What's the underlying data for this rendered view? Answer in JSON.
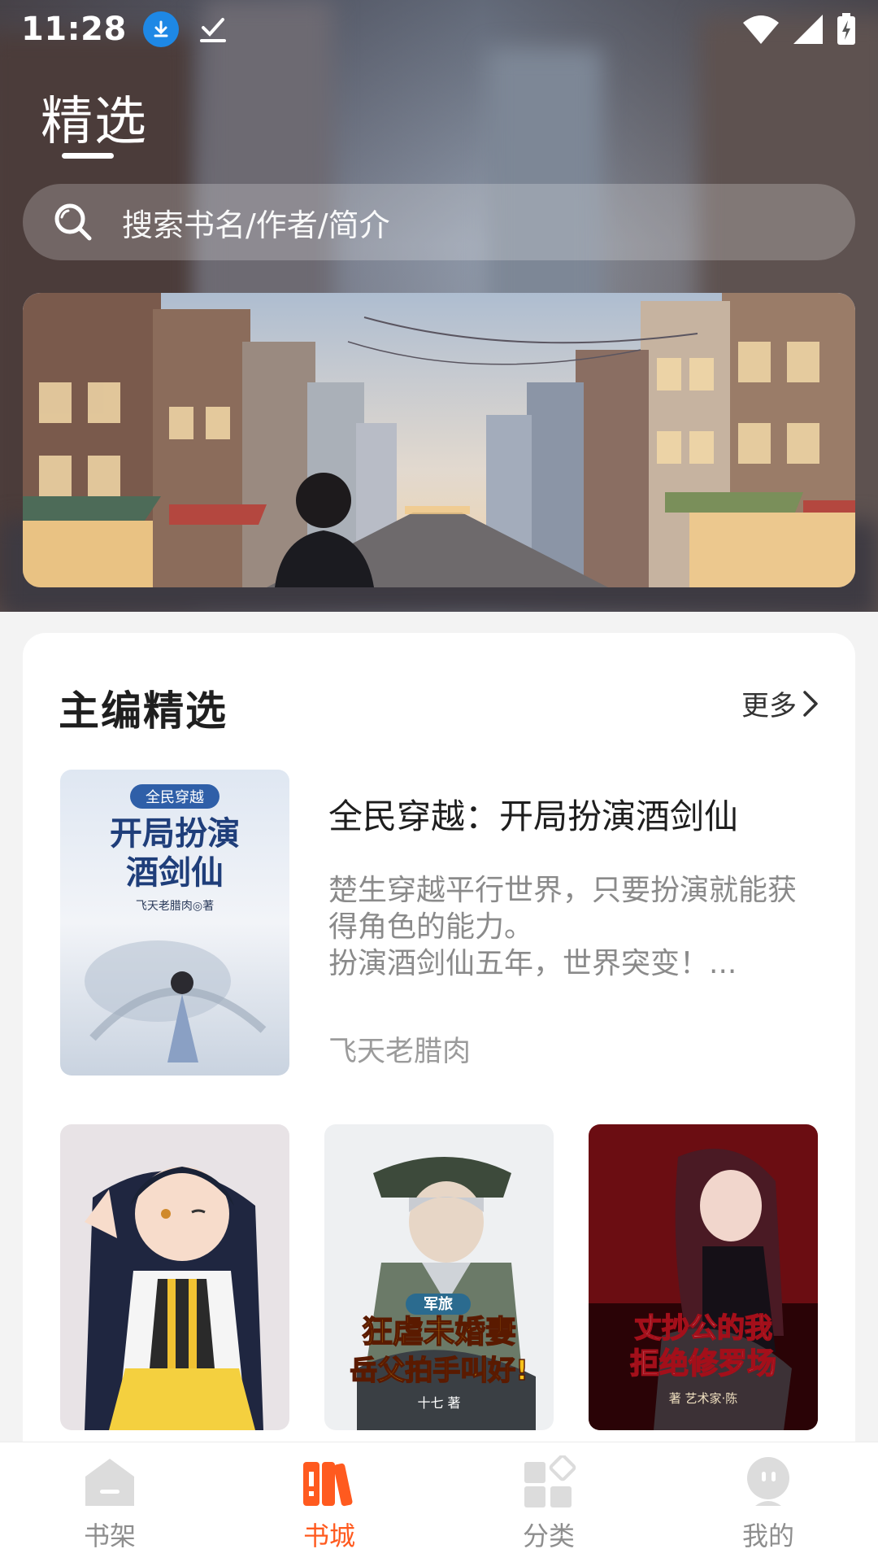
{
  "status": {
    "time": "11:28"
  },
  "header": {
    "tab_label": "精选"
  },
  "search": {
    "placeholder": "搜索书名/作者/简介"
  },
  "section": {
    "title": "主编精选",
    "more_label": "更多"
  },
  "featured_book": {
    "title": "全民穿越：开局扮演酒剑仙",
    "description": "楚生穿越平行世界，只要扮演就能获得角色的能力。\n扮演酒剑仙五年，世界突变！...",
    "author": "飞天老腊肉",
    "cover_text": {
      "top": "全民穿越",
      "main": "开局扮演酒剑仙",
      "byline": "飞天老腊肉◎著"
    }
  },
  "books": [
    {
      "cover_text": ""
    },
    {
      "cover_text": "军旅 狂虐未婚妻岳父拍手叫好！",
      "badge": "军旅",
      "line1": "狂虐未婚妻",
      "line2": "岳父拍手叫好!",
      "byline": "十七 著"
    },
    {
      "cover_text": "丈抄公的我拒绝修罗场",
      "line1": "丈抄公的我",
      "line2": "拒绝修罗场",
      "byline": "著 艺术家·陈"
    }
  ],
  "nav": {
    "items": [
      {
        "label": "书架",
        "icon": "bookshelf-icon"
      },
      {
        "label": "书城",
        "icon": "bookstore-icon"
      },
      {
        "label": "分类",
        "icon": "category-icon"
      },
      {
        "label": "我的",
        "icon": "profile-icon"
      }
    ],
    "active_color": "#ff5a1f"
  }
}
